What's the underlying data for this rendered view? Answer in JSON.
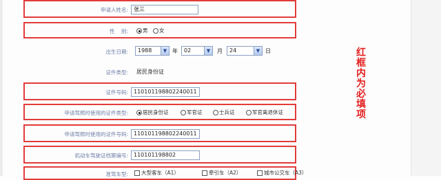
{
  "fields": {
    "applicant_name": {
      "label": "申请人姓名:",
      "value": "张三"
    },
    "gender": {
      "label": "性    别:",
      "options": [
        "男",
        "女"
      ],
      "selected": "男"
    },
    "birth_date": {
      "label": "出生日期:",
      "year": "1988",
      "year_unit": "年",
      "month": "02",
      "month_unit": "月",
      "day": "24",
      "day_unit": "日"
    },
    "id_type": {
      "label": "证件类型:",
      "value": "居民身份证"
    },
    "id_number": {
      "label": "证件号码:",
      "value": "110101198802240011"
    },
    "license_id_type": {
      "label": "申请驾照时使用的证件类型:",
      "options": [
        "居民身份证",
        "军官证",
        "士兵证",
        "军官离退休证"
      ],
      "selected": "居民身份证"
    },
    "license_id_number": {
      "label": "申请驾照时使用的证件号码:",
      "value": "110101198802240011"
    },
    "license_file_number": {
      "label": "机动车驾驶证档案编号:",
      "value": "110101198802"
    },
    "license_class": {
      "label": "准驾车型:",
      "options": [
        "大型客车（A1）",
        "牵引车（A2）",
        "城市公交车（A3）"
      ]
    }
  },
  "annotation": {
    "chars": [
      "红",
      "框",
      "内",
      "为",
      "必",
      "填",
      "项"
    ]
  },
  "colors": {
    "highlight_border": "#e23a3a",
    "annotation_text": "#e31f1f",
    "label_text": "#6e7fa8"
  }
}
